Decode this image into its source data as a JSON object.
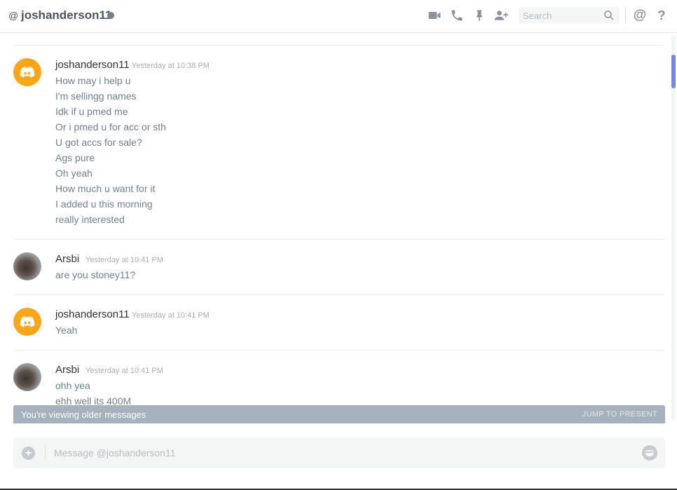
{
  "header": {
    "at_symbol": "@",
    "username": "joshanderson11",
    "icons": [
      "video-call-icon",
      "voice-call-icon",
      "pin-icon",
      "add-friend-icon",
      "mention-icon",
      "help-icon"
    ],
    "mention_glyph": "@",
    "help_glyph": "?"
  },
  "search": {
    "placeholder": "Search",
    "value": ""
  },
  "messages": [
    {
      "author": "joshanderson11",
      "timestamp": "Yesterday at 10:38 PM",
      "avatar": "discord-default",
      "lines": [
        "How may i help u",
        "I'm sellingg names",
        "Idk if u pmed me",
        "Or i pmed u for acc or sth",
        "U got accs for sale?",
        "Ags pure",
        "Oh yeah",
        "How much u want for it",
        "I added u this morning",
        "really interested"
      ]
    },
    {
      "author": "Arsbi",
      "timestamp": "Yesterday at 10:41 PM",
      "avatar": "photo",
      "lines": [
        "are you stoney11?"
      ]
    },
    {
      "author": "joshanderson11",
      "timestamp": "Yesterday at 10:41 PM",
      "avatar": "discord-default",
      "lines": [
        "Yeah"
      ]
    },
    {
      "author": "Arsbi",
      "timestamp": "Yesterday at 10:41 PM",
      "avatar": "photo",
      "lines": [
        "ohh yea",
        "ehh well its 400M"
      ]
    }
  ],
  "older_bar": {
    "text": "You're viewing older messages",
    "jump_label": "JUMP TO PRESENT"
  },
  "composer": {
    "placeholder": "Message @joshanderson11",
    "value": ""
  },
  "colors": {
    "accent": "#7289da",
    "discord_avatar": "#faa61a",
    "older_bar": "#a5b1bc"
  }
}
